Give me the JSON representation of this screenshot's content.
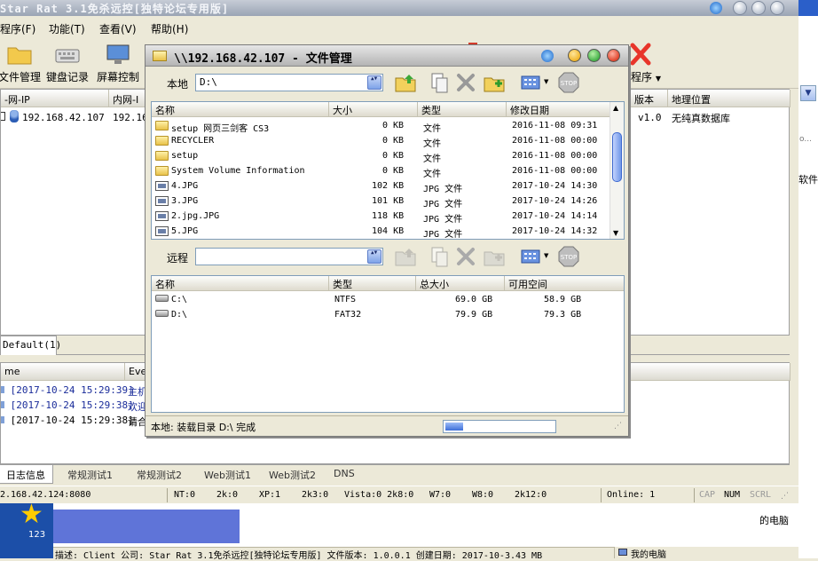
{
  "main": {
    "title": "Star Rat 3.1免杀远控[独特论坛专用版]",
    "menu": [
      "程序(F)",
      "功能(T)",
      "查看(V)",
      "帮助(H)"
    ],
    "toolbar": {
      "file_manager": "文件管理",
      "keylogger": "键盘记录",
      "screen_control": "屏幕控制",
      "exit_program": "出程序"
    },
    "list_headers": [
      "-网-IP",
      "内网-I",
      "版本",
      "地理位置"
    ],
    "client": {
      "wan_ip": "192.168.42.107",
      "lan_ip": "192.16",
      "version": "v1.0",
      "location": "无纯真数据库"
    },
    "side_text_1": "o...",
    "side_text_2": "软件",
    "group_tab": "Default(1)",
    "log_headers": [
      "me",
      "Eve"
    ],
    "logs": [
      {
        "time": "[2017-10-24 15:29:39]",
        "event": "主机"
      },
      {
        "time": "[2017-10-24 15:29:38]",
        "event": "欢迎"
      },
      {
        "time": "[2017-10-24 15:29:38]",
        "event": "请合"
      }
    ],
    "bottom_tabs": [
      "日志信息",
      "常规测试1",
      "常规测试2",
      "Web测试1",
      "Web测试2",
      "DNS"
    ],
    "status": {
      "listen": "2.168.42.124:8080",
      "nt": "NT:0",
      "k2": "2k:0",
      "xp": "XP:1",
      "k3": "2k3:0",
      "vista": "Vista:0 2k8:0",
      "w7": "W7:0",
      "w8": "W8:0",
      "k12": "2k12:0",
      "online": "Online: 1",
      "cap": "CAP",
      "num": "NUM",
      "scrl": "SCRL"
    },
    "desktop": {
      "icon_label": "123",
      "right_label": "的电脑",
      "description": "描述: Client 公司: Star Rat 3.1免杀远控[独特论坛专用版] 文件版本: 1.0.0.1 创建日期: 2017-10-3.43 MB",
      "my_computer": "我的电脑"
    }
  },
  "fm": {
    "title": "\\\\192.168.42.107 - 文件管理",
    "local_label": "本地",
    "local_path": "D:\\",
    "local_headers": [
      "名称",
      "大小",
      "类型",
      "修改日期"
    ],
    "local_files": [
      {
        "name": "setup 网页三剑客 CS3",
        "size": "0 KB",
        "type": "文件",
        "date": "2016-11-08 09:31",
        "kind": "folder"
      },
      {
        "name": "RECYCLER",
        "size": "0 KB",
        "type": "文件",
        "date": "2016-11-08 00:00",
        "kind": "folder"
      },
      {
        "name": "setup",
        "size": "0 KB",
        "type": "文件",
        "date": "2016-11-08 00:00",
        "kind": "folder"
      },
      {
        "name": "System Volume Information",
        "size": "0 KB",
        "type": "文件",
        "date": "2016-11-08 00:00",
        "kind": "folder"
      },
      {
        "name": "4.JPG",
        "size": "102 KB",
        "type": "JPG 文件",
        "date": "2017-10-24 14:30",
        "kind": "image"
      },
      {
        "name": "3.JPG",
        "size": "101 KB",
        "type": "JPG 文件",
        "date": "2017-10-24 14:26",
        "kind": "image"
      },
      {
        "name": "2.jpg.JPG",
        "size": "118 KB",
        "type": "JPG 文件",
        "date": "2017-10-24 14:14",
        "kind": "image"
      },
      {
        "name": "5.JPG",
        "size": "104 KB",
        "type": "JPG 文件",
        "date": "2017-10-24 14:32",
        "kind": "image"
      }
    ],
    "remote_label": "远程",
    "remote_path": "",
    "remote_headers": [
      "名称",
      "类型",
      "总大小",
      "可用空间"
    ],
    "remote_drives": [
      {
        "name": "C:\\",
        "type": "NTFS",
        "total": "69.0 GB",
        "free": "58.9 GB"
      },
      {
        "name": "D:\\",
        "type": "FAT32",
        "total": "79.9 GB",
        "free": "79.3 GB"
      }
    ],
    "status_text": "本地: 装载目录 D:\\ 完成",
    "progress": 0.16,
    "colors": {
      "close": "#e0452c",
      "minimize": "#f0b429",
      "maximize": "#44b248"
    }
  }
}
